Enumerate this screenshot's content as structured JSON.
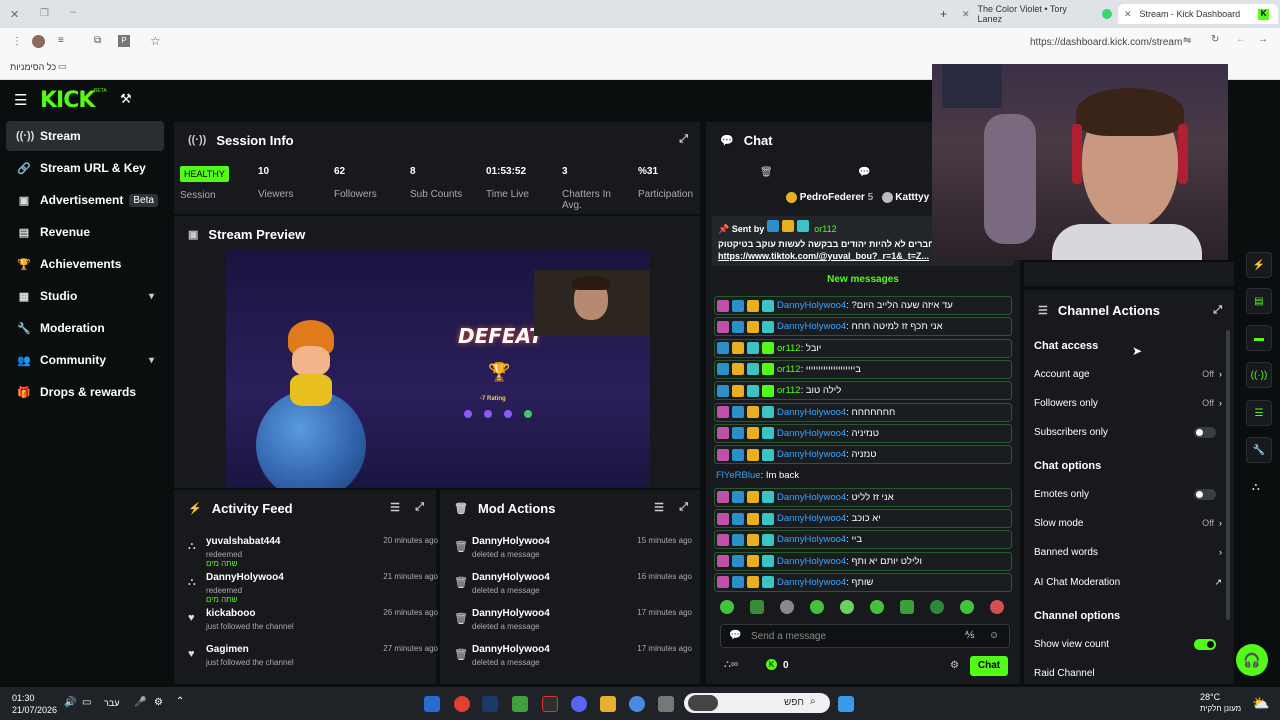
{
  "browser": {
    "tabs": [
      {
        "title": "The Color Violet • Tory Lanez"
      },
      {
        "title": "Stream - Kick Dashboard"
      }
    ],
    "url": "https://dashboard.kick.com/stream",
    "bookmarks_label": "כל הסימניות"
  },
  "brand": {
    "logo": "KICK",
    "beta": "BETA",
    "accent": "#53fc18"
  },
  "sidebar": {
    "items": [
      {
        "label": "Stream",
        "icon": "radio-icon"
      },
      {
        "label": "Stream URL & Key",
        "icon": "link-icon"
      },
      {
        "label": "Advertisement",
        "icon": "monitor-icon",
        "badge": "Beta"
      },
      {
        "label": "Revenue",
        "icon": "chart-icon"
      },
      {
        "label": "Achievements",
        "icon": "trophy-icon"
      },
      {
        "label": "Studio",
        "icon": "grid-icon"
      },
      {
        "label": "Moderation",
        "icon": "wrench-icon"
      },
      {
        "label": "Community",
        "icon": "users-icon"
      },
      {
        "label": "Drops & rewards",
        "icon": "gift-icon"
      }
    ]
  },
  "session": {
    "title": "Session Info",
    "status": "HEALTHY",
    "status_label": "Session",
    "stats": [
      {
        "value": "10",
        "label": "Viewers"
      },
      {
        "value": "62",
        "label": "Followers"
      },
      {
        "value": "8",
        "label": "Sub Counts"
      },
      {
        "value": "01:53:52",
        "label": "Time Live"
      },
      {
        "value": "3",
        "label": "Chatters In Avg."
      },
      {
        "value": "%31",
        "label": "Participation"
      }
    ]
  },
  "preview": {
    "title": "Stream Preview",
    "game_text": "DEFEAT",
    "rating": "-7 Rating"
  },
  "activity": {
    "title": "Activity Feed",
    "items": [
      {
        "name": "yuvalshabat444",
        "action": "redeemed",
        "reward": "שתה מים",
        "time": "20 minutes ago"
      },
      {
        "name": "DannyHolywoo4",
        "action": "redeemed",
        "reward": "שתה מים",
        "time": "21 minutes ago"
      },
      {
        "name": "kickabooo",
        "action": "just followed the channel",
        "reward": "",
        "time": "26 minutes ago"
      },
      {
        "name": "Gagimen",
        "action": "just followed the channel",
        "reward": "",
        "time": "27 minutes ago"
      }
    ]
  },
  "mod": {
    "title": "Mod Actions",
    "items": [
      {
        "name": "DannyHolywoo4",
        "action": "deleted a message",
        "time": "15 minutes ago"
      },
      {
        "name": "DannyHolywoo4",
        "action": "deleted a message",
        "time": "16 minutes ago"
      },
      {
        "name": "DannyHolywoo4",
        "action": "deleted a message",
        "time": "17 minutes ago"
      },
      {
        "name": "DannyHolywoo4",
        "action": "deleted a message",
        "time": "17 minutes ago"
      }
    ]
  },
  "chat": {
    "title": "Chat",
    "top_users": [
      {
        "name": "PedroFederer",
        "count": "5"
      },
      {
        "name": "Katttyy",
        "count": ""
      }
    ],
    "pinned": {
      "sent_by_label": "Sent by",
      "user": "or112",
      "text": "חברים לא להיות יהודים בבקשה לעשות עוקב בטיקטוק",
      "link": "https://www.tiktok.com/@yuval_bou?_r=1&_t=Z..."
    },
    "new_messages": "New messages",
    "messages": [
      {
        "user": "DannyHolywoo4",
        "text": "עד איזה שעה הלייב היום?",
        "color": "blue"
      },
      {
        "user": "DannyHolywoo4",
        "text": "אני תכף זז למיטה חחח",
        "color": "blue"
      },
      {
        "user": "or112",
        "text": "יובל",
        "color": "green"
      },
      {
        "user": "or112",
        "text": "ביייייייייייייייייייי",
        "color": "green"
      },
      {
        "user": "or112",
        "text": "לילה טוב",
        "color": "green"
      },
      {
        "user": "DannyHolywoo4",
        "text": "חחחחחחח",
        "color": "blue"
      },
      {
        "user": "DannyHolywoo4",
        "text": "טנזיניה",
        "color": "blue"
      },
      {
        "user": "DannyHolywoo4",
        "text": "טנזניה",
        "color": "blue"
      },
      {
        "user": "FlYeRBlue",
        "text": "Im back",
        "color": "plain"
      },
      {
        "user": "DannyHolywoo4",
        "text": "אני זז לליט",
        "color": "blue"
      },
      {
        "user": "DannyHolywoo4",
        "text": "יא כוכב",
        "color": "blue"
      },
      {
        "user": "DannyHolywoo4",
        "text": "ביי",
        "color": "blue"
      },
      {
        "user": "DannyHolywoo4",
        "text": "ולילט יותם יא ותף",
        "color": "blue"
      },
      {
        "user": "DannyHolywoo4",
        "text": "שותף",
        "color": "blue"
      }
    ],
    "input_placeholder": "Send a message",
    "points": "0",
    "send_label": "Chat"
  },
  "channel_actions": {
    "title": "Channel Actions",
    "chat_access": "Chat access",
    "account_age": {
      "label": "Account age",
      "value": "Off"
    },
    "followers_only": {
      "label": "Followers only",
      "value": "Off"
    },
    "subscribers_only": {
      "label": "Subscribers only",
      "on": false
    },
    "chat_options": "Chat options",
    "emotes_only": {
      "label": "Emotes only",
      "on": false
    },
    "slow_mode": {
      "label": "Slow mode",
      "value": "Off"
    },
    "banned_words": {
      "label": "Banned words"
    },
    "ai_moderation": {
      "label": "AI Chat Moderation"
    },
    "channel_options": "Channel options",
    "show_view_count": {
      "label": "Show view count",
      "on": true
    },
    "raid_channel": {
      "label": "Raid Channel"
    }
  },
  "taskbar": {
    "time": "01:30",
    "date": "21/07/2026",
    "lang": "עבר",
    "search_placeholder": "חפש",
    "weather_temp": "28°C",
    "weather_text": "מעונן חלקית"
  }
}
